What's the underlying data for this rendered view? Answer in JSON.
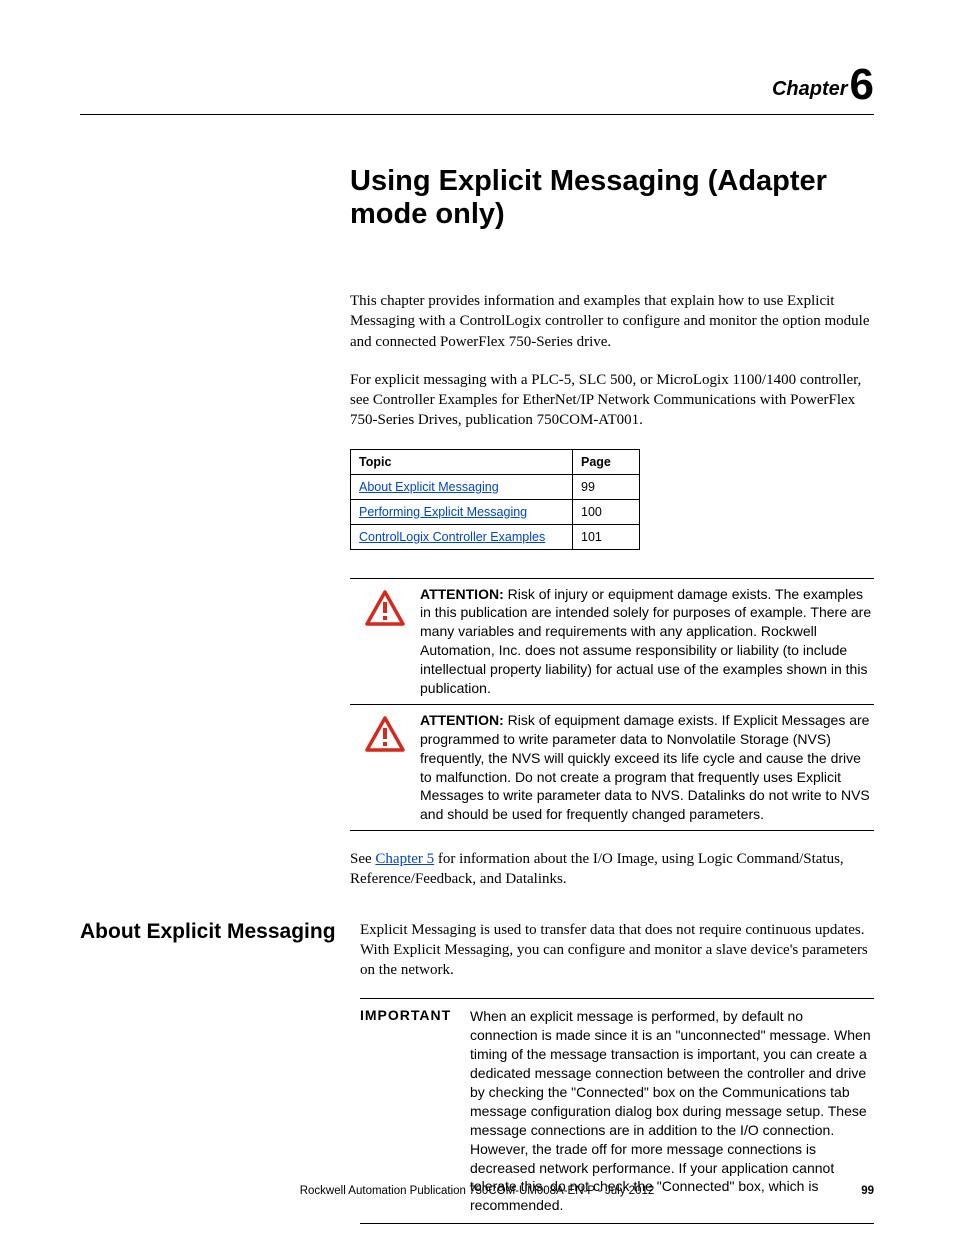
{
  "chapter": {
    "label": "Chapter",
    "number": "6"
  },
  "title": "Using Explicit Messaging (Adapter mode only)",
  "intro": [
    "This chapter provides information and examples that explain how to use Explicit Messaging with a ControlLogix controller to configure and monitor the option module and connected PowerFlex 750-Series drive.",
    "For explicit messaging with a PLC-5, SLC 500, or MicroLogix 1100/1400 controller, see Controller Examples for EtherNet/IP Network Communications with PowerFlex 750-Series Drives, publication 750COM-AT001."
  ],
  "toc": {
    "headers": {
      "topic": "Topic",
      "page": "Page"
    },
    "rows": [
      {
        "topic": "About Explicit Messaging",
        "page": "99"
      },
      {
        "topic": "Performing Explicit Messaging",
        "page": "100"
      },
      {
        "topic": "ControlLogix Controller Examples",
        "page": "101"
      }
    ]
  },
  "attentions": [
    {
      "label": "ATTENTION:",
      "text": " Risk of injury or equipment damage exists. The examples in this publication are intended solely for purposes of example. There are many variables and requirements with any application. Rockwell Automation, Inc. does not assume responsibility or liability (to include intellectual property liability) for actual use of the examples shown in this publication."
    },
    {
      "label": "ATTENTION:",
      "text": " Risk of equipment damage exists. If Explicit Messages are programmed to write parameter data to Nonvolatile Storage (NVS) frequently, the NVS will quickly exceed its life cycle and cause the drive to malfunction. Do not create a program that frequently uses Explicit Messages to write parameter data to NVS. Datalinks do not write to NVS and should be used for frequently changed parameters."
    }
  ],
  "see_chapter": {
    "prefix": "See ",
    "link": "Chapter 5",
    "suffix": " for information about the I/O Image, using Logic Command/Status, Reference/Feedback, and Datalinks."
  },
  "section": {
    "heading": "About Explicit Messaging",
    "body": "Explicit Messaging is used to transfer data that does not require continuous updates. With Explicit Messaging, you can configure and monitor a slave device's parameters on the network."
  },
  "important": {
    "label": "IMPORTANT",
    "text": "When an explicit message is performed, by default no connection is made since it is an \"unconnected\" message. When timing of the message transaction is important, you can create a dedicated message connection between the controller and drive by checking the \"Connected\" box on the Communications tab message configuration dialog box during message setup. These message connections are in addition to the I/O connection. However, the trade off for more message connections is decreased network performance. If your application cannot tolerate this, do not check the \"Connected\" box, which is recommended."
  },
  "footer": {
    "text": "Rockwell Automation Publication 750COM-UM008A-EN-P - July 2012",
    "page": "99"
  }
}
